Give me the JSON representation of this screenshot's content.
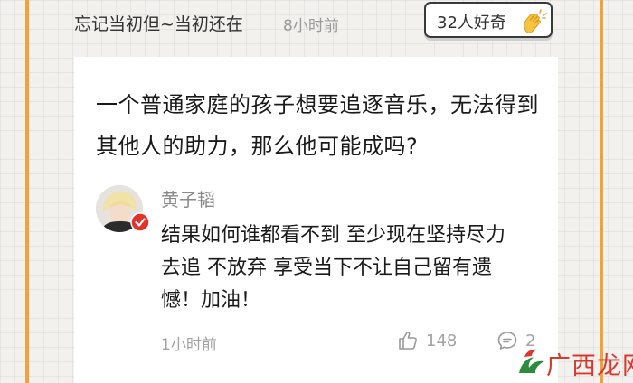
{
  "header": {
    "author": "忘记当初但~当初还在",
    "time": "8小时前",
    "curious_label": "32人好奇"
  },
  "question": {
    "text": "一个普通家庭的孩子想要追逐音乐，无法得到其他人的助力，那么他可能成吗?"
  },
  "answer": {
    "author": "黄子韬",
    "text": "结果如何谁都看不到 至少现在坚持尽力去追 不放弃 享受当下不让自己留有遗憾！加油！",
    "time": "1小时前",
    "likes": "148",
    "comments": "2"
  },
  "watermark": {
    "text": "广西龙网"
  },
  "icons": {
    "clap": "clapping-hands-icon",
    "like": "thumbs-up-icon",
    "comment": "comment-bubble-icon",
    "verified": "verified-badge-icon"
  },
  "colors": {
    "frame_accent": "#f2a23c",
    "verified_red": "#e0342a",
    "clap_yellow": "#f5c542",
    "watermark_red": "#d93a2f"
  }
}
